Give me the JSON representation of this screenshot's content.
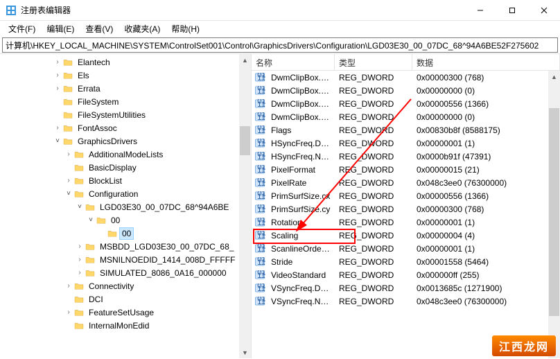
{
  "window": {
    "title": "注册表编辑器"
  },
  "menu": {
    "file": "文件(F)",
    "edit": "编辑(E)",
    "view": "查看(V)",
    "favorites": "收藏夹(A)",
    "help": "帮助(H)"
  },
  "address": "计算机\\HKEY_LOCAL_MACHINE\\SYSTEM\\ControlSet001\\Control\\GraphicsDrivers\\Configuration\\LGD03E30_00_07DC_68^94A6BE52F275602",
  "tree": [
    {
      "indent": 4,
      "toggle": ">",
      "label": "Elantech"
    },
    {
      "indent": 4,
      "toggle": ">",
      "label": "Els"
    },
    {
      "indent": 4,
      "toggle": ">",
      "label": "Errata"
    },
    {
      "indent": 4,
      "toggle": "",
      "label": "FileSystem"
    },
    {
      "indent": 4,
      "toggle": "",
      "label": "FileSystemUtilities"
    },
    {
      "indent": 4,
      "toggle": ">",
      "label": "FontAssoc"
    },
    {
      "indent": 4,
      "toggle": "v",
      "label": "GraphicsDrivers"
    },
    {
      "indent": 5,
      "toggle": ">",
      "label": "AdditionalModeLists"
    },
    {
      "indent": 5,
      "toggle": "",
      "label": "BasicDisplay"
    },
    {
      "indent": 5,
      "toggle": ">",
      "label": "BlockList"
    },
    {
      "indent": 5,
      "toggle": "v",
      "label": "Configuration"
    },
    {
      "indent": 6,
      "toggle": "v",
      "label": "LGD03E30_00_07DC_68^94A6BE"
    },
    {
      "indent": 7,
      "toggle": "v",
      "label": "00"
    },
    {
      "indent": 8,
      "toggle": "",
      "label": "00",
      "selected": true
    },
    {
      "indent": 6,
      "toggle": ">",
      "label": "MSBDD_LGD03E30_00_07DC_68_"
    },
    {
      "indent": 6,
      "toggle": ">",
      "label": "MSNILNOEDID_1414_008D_FFFFF"
    },
    {
      "indent": 6,
      "toggle": ">",
      "label": "SIMULATED_8086_0A16_000000"
    },
    {
      "indent": 5,
      "toggle": ">",
      "label": "Connectivity"
    },
    {
      "indent": 5,
      "toggle": "",
      "label": "DCI"
    },
    {
      "indent": 5,
      "toggle": ">",
      "label": "FeatureSetUsage"
    },
    {
      "indent": 5,
      "toggle": "",
      "label": "InternalMonEdid"
    }
  ],
  "columns": {
    "name": "名称",
    "type": "类型",
    "data": "数据"
  },
  "values": [
    {
      "name": "DwmClipBox.b...",
      "type": "REG_DWORD",
      "data": "0x00000300 (768)"
    },
    {
      "name": "DwmClipBox.left",
      "type": "REG_DWORD",
      "data": "0x00000000 (0)"
    },
    {
      "name": "DwmClipBox.ri...",
      "type": "REG_DWORD",
      "data": "0x00000556 (1366)"
    },
    {
      "name": "DwmClipBox.top",
      "type": "REG_DWORD",
      "data": "0x00000000 (0)"
    },
    {
      "name": "Flags",
      "type": "REG_DWORD",
      "data": "0x00830b8f (8588175)"
    },
    {
      "name": "HSyncFreq.Den...",
      "type": "REG_DWORD",
      "data": "0x00000001 (1)"
    },
    {
      "name": "HSyncFreq.Nu...",
      "type": "REG_DWORD",
      "data": "0x0000b91f (47391)"
    },
    {
      "name": "PixelFormat",
      "type": "REG_DWORD",
      "data": "0x00000015 (21)"
    },
    {
      "name": "PixelRate",
      "type": "REG_DWORD",
      "data": "0x048c3ee0 (76300000)"
    },
    {
      "name": "PrimSurfSize.cx",
      "type": "REG_DWORD",
      "data": "0x00000556 (1366)"
    },
    {
      "name": "PrimSurfSize.cy",
      "type": "REG_DWORD",
      "data": "0x00000300 (768)"
    },
    {
      "name": "Rotation",
      "type": "REG_DWORD",
      "data": "0x00000001 (1)"
    },
    {
      "name": "Scaling",
      "type": "REG_DWORD",
      "data": "0x00000004 (4)"
    },
    {
      "name": "ScanlineOrderi...",
      "type": "REG_DWORD",
      "data": "0x00000001 (1)"
    },
    {
      "name": "Stride",
      "type": "REG_DWORD",
      "data": "0x00001558 (5464)"
    },
    {
      "name": "VideoStandard",
      "type": "REG_DWORD",
      "data": "0x000000ff (255)"
    },
    {
      "name": "VSyncFreq.Den...",
      "type": "REG_DWORD",
      "data": "0x0013685c (1271900)"
    },
    {
      "name": "VSyncFreq.Nu...",
      "type": "REG_DWORD",
      "data": "0x048c3ee0 (76300000)"
    }
  ],
  "watermark": "江西龙网"
}
